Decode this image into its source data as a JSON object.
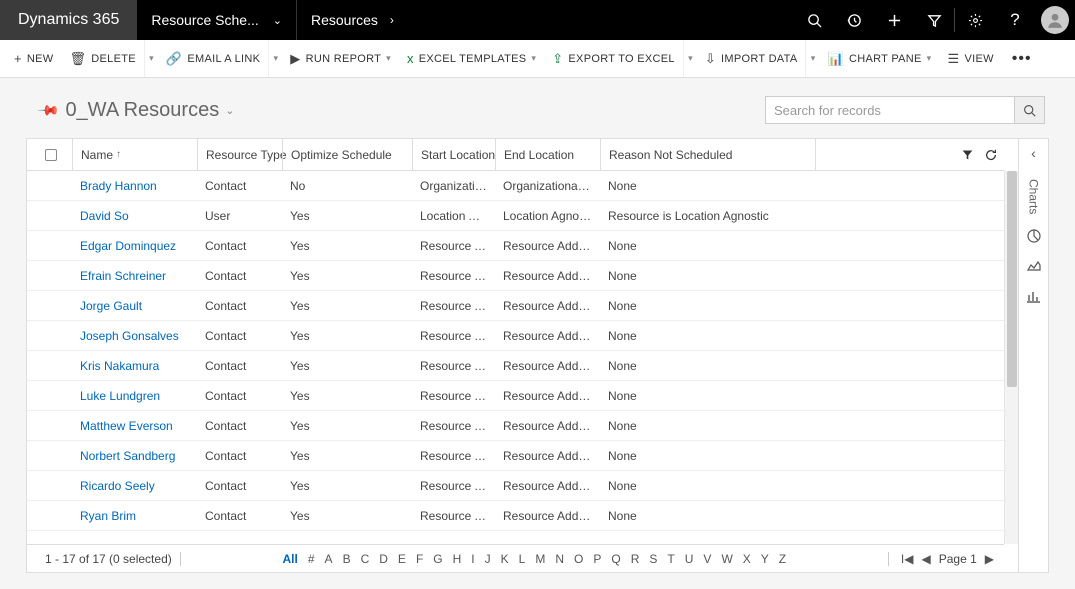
{
  "topbar": {
    "brand": "Dynamics 365",
    "area": "Resource Sche...",
    "subarea": "Resources"
  },
  "cmdbar": {
    "new": "New",
    "delete": "Delete",
    "email": "Email a Link",
    "run_report": "Run Report",
    "excel_tpl": "Excel Templates",
    "export_excel": "Export to Excel",
    "import": "Import Data",
    "chart_pane": "Chart Pane",
    "view": "View"
  },
  "view": {
    "title": "0_WA Resources",
    "search_placeholder": "Search for records"
  },
  "columns": {
    "name": "Name",
    "type": "Resource Type",
    "optimize": "Optimize Schedule",
    "start": "Start Location",
    "end": "End Location",
    "reason": "Reason Not Scheduled"
  },
  "rows": [
    {
      "name": "Brady Hannon",
      "type": "Contact",
      "opt": "No",
      "start": "Organization...",
      "end": "Organizational Un...",
      "reason": "None"
    },
    {
      "name": "David So",
      "type": "User",
      "opt": "Yes",
      "start": "Location Agn...",
      "end": "Location Agnostic",
      "reason": "Resource is Location Agnostic"
    },
    {
      "name": "Edgar Dominquez",
      "type": "Contact",
      "opt": "Yes",
      "start": "Resource Add...",
      "end": "Resource Address",
      "reason": "None"
    },
    {
      "name": "Efrain Schreiner",
      "type": "Contact",
      "opt": "Yes",
      "start": "Resource Add...",
      "end": "Resource Address",
      "reason": "None"
    },
    {
      "name": "Jorge Gault",
      "type": "Contact",
      "opt": "Yes",
      "start": "Resource Add...",
      "end": "Resource Address",
      "reason": "None"
    },
    {
      "name": "Joseph Gonsalves",
      "type": "Contact",
      "opt": "Yes",
      "start": "Resource Add...",
      "end": "Resource Address",
      "reason": "None"
    },
    {
      "name": "Kris Nakamura",
      "type": "Contact",
      "opt": "Yes",
      "start": "Resource Add...",
      "end": "Resource Address",
      "reason": "None"
    },
    {
      "name": "Luke Lundgren",
      "type": "Contact",
      "opt": "Yes",
      "start": "Resource Add...",
      "end": "Resource Address",
      "reason": "None"
    },
    {
      "name": "Matthew Everson",
      "type": "Contact",
      "opt": "Yes",
      "start": "Resource Add...",
      "end": "Resource Address",
      "reason": "None"
    },
    {
      "name": "Norbert Sandberg",
      "type": "Contact",
      "opt": "Yes",
      "start": "Resource Add...",
      "end": "Resource Address",
      "reason": "None"
    },
    {
      "name": "Ricardo Seely",
      "type": "Contact",
      "opt": "Yes",
      "start": "Resource Add...",
      "end": "Resource Address",
      "reason": "None"
    },
    {
      "name": "Ryan Brim",
      "type": "Contact",
      "opt": "Yes",
      "start": "Resource Add...",
      "end": "Resource Address",
      "reason": "None"
    }
  ],
  "footer": {
    "status": "1 - 17 of 17 (0 selected)",
    "all_label": "All",
    "letters": [
      "#",
      "A",
      "B",
      "C",
      "D",
      "E",
      "F",
      "G",
      "H",
      "I",
      "J",
      "K",
      "L",
      "M",
      "N",
      "O",
      "P",
      "Q",
      "R",
      "S",
      "T",
      "U",
      "V",
      "W",
      "X",
      "Y",
      "Z"
    ],
    "page_label": "Page 1"
  },
  "charts_panel": {
    "label": "Charts"
  }
}
